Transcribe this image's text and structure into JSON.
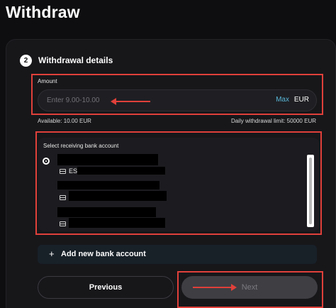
{
  "page": {
    "title": "Withdraw"
  },
  "step": {
    "number": "2",
    "title": "Withdrawal details"
  },
  "amount": {
    "label": "Amount",
    "placeholder": "Enter 9.00-10.00",
    "value": "",
    "max_label": "Max",
    "currency": "EUR",
    "available": "Available: 10.00 EUR",
    "daily_limit": "Daily withdrawal limit: 50000 EUR"
  },
  "bank": {
    "title": "Select receiving bank account",
    "accounts": [
      {
        "iban_prefix": "ES",
        "selected": true
      },
      {
        "iban_prefix": "",
        "selected": false
      },
      {
        "iban_prefix": "",
        "selected": false
      }
    ]
  },
  "add_bank": {
    "plus": "+",
    "label": "Add new bank account"
  },
  "actions": {
    "previous_label": "Previous",
    "next_label": "Next"
  },
  "colors": {
    "accent": "#58b4d6",
    "highlight": "#e0403a",
    "background": "#0e0e10",
    "card": "#17171a"
  },
  "icons": [
    "card-icon",
    "plus-icon",
    "arrow-icon"
  ]
}
